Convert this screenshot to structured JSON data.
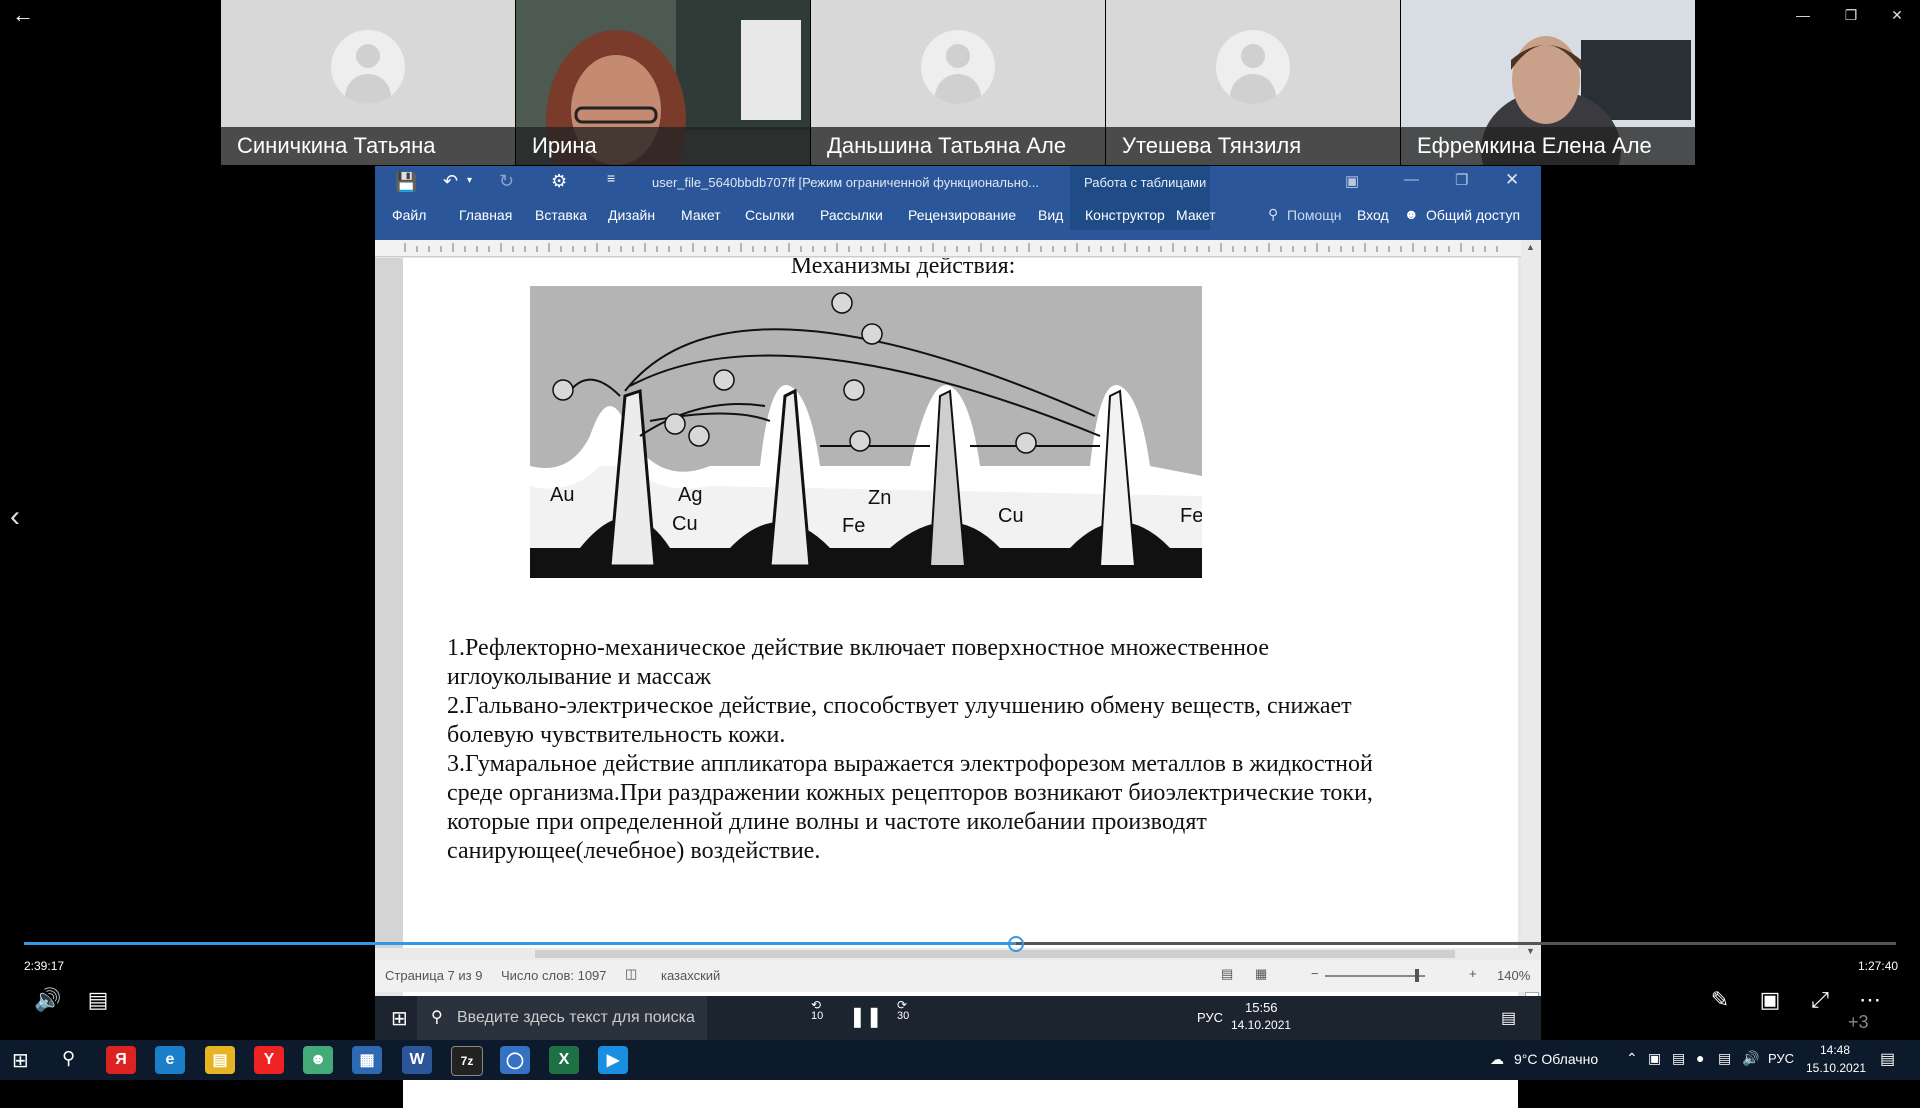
{
  "player": {
    "elapsed": "2:39:17",
    "remaining": "1:27:40",
    "progress": 0.53,
    "overflow_badge": "+3"
  },
  "participants": [
    {
      "name": "Синичкина Татьяна",
      "video": false
    },
    {
      "name": "Ирина",
      "video": true
    },
    {
      "name": "Даньшина Татьяна Але",
      "video": false
    },
    {
      "name": "Утешева Тянзиля",
      "video": false
    },
    {
      "name": "Ефремкина Елена Але",
      "video": true
    }
  ],
  "word": {
    "title": "user_file_5640bbdb707ff [Режим ограниченной функционально...",
    "contextual": "Работа с таблицами",
    "tabs": [
      "Файл",
      "Главная",
      "Вставка",
      "Дизайн",
      "Макет",
      "Ссылки",
      "Рассылки",
      "Рецензирование",
      "Вид"
    ],
    "tool_tabs": [
      "Конструктор",
      "Макет"
    ],
    "help": "Помощн",
    "signin": "Вход",
    "share": "Общий доступ",
    "heading": "Механизмы действия:",
    "figure_labels": [
      "Au",
      "Ag",
      "Cu",
      "Zn",
      "Fe",
      "Cu",
      "Fe"
    ],
    "paragraphs": [
      "1.Рефлекторно-механическое действие включает поверхностное множественное",
      "иглоуколывание и массаж",
      "2.Гальвано-электрическое действие, способствует улучшению обмену веществ, снижает",
      "болевую чувствительность кожи.",
      "3.Гумаральное действие аппликатора выражается электрофорезом металлов в жидкостной",
      "среде организма.При раздражении кожных рецепторов возникают биоэлектрические токи,",
      "которые при определенной длине волны и частоте иколебании производят",
      "санирующее(лечебное) воздействие."
    ],
    "status": {
      "page": "Страница 7 из 9",
      "words": "Число слов: 1097",
      "lang": "казахский",
      "zoom": "140%"
    }
  },
  "inner_taskbar": {
    "search_placeholder": "Введите здесь текст для поиска",
    "time": "15:56",
    "date": "14.10.2021",
    "lang": "РУС",
    "rewind": "10",
    "forward": "30"
  },
  "taskbar": {
    "weather": "9°C Облачно",
    "lang": "РУС",
    "time": "14:48",
    "date": "15.10.2021"
  },
  "colors": {
    "word_blue": "#2b579a",
    "progress": "#3a96dd"
  }
}
